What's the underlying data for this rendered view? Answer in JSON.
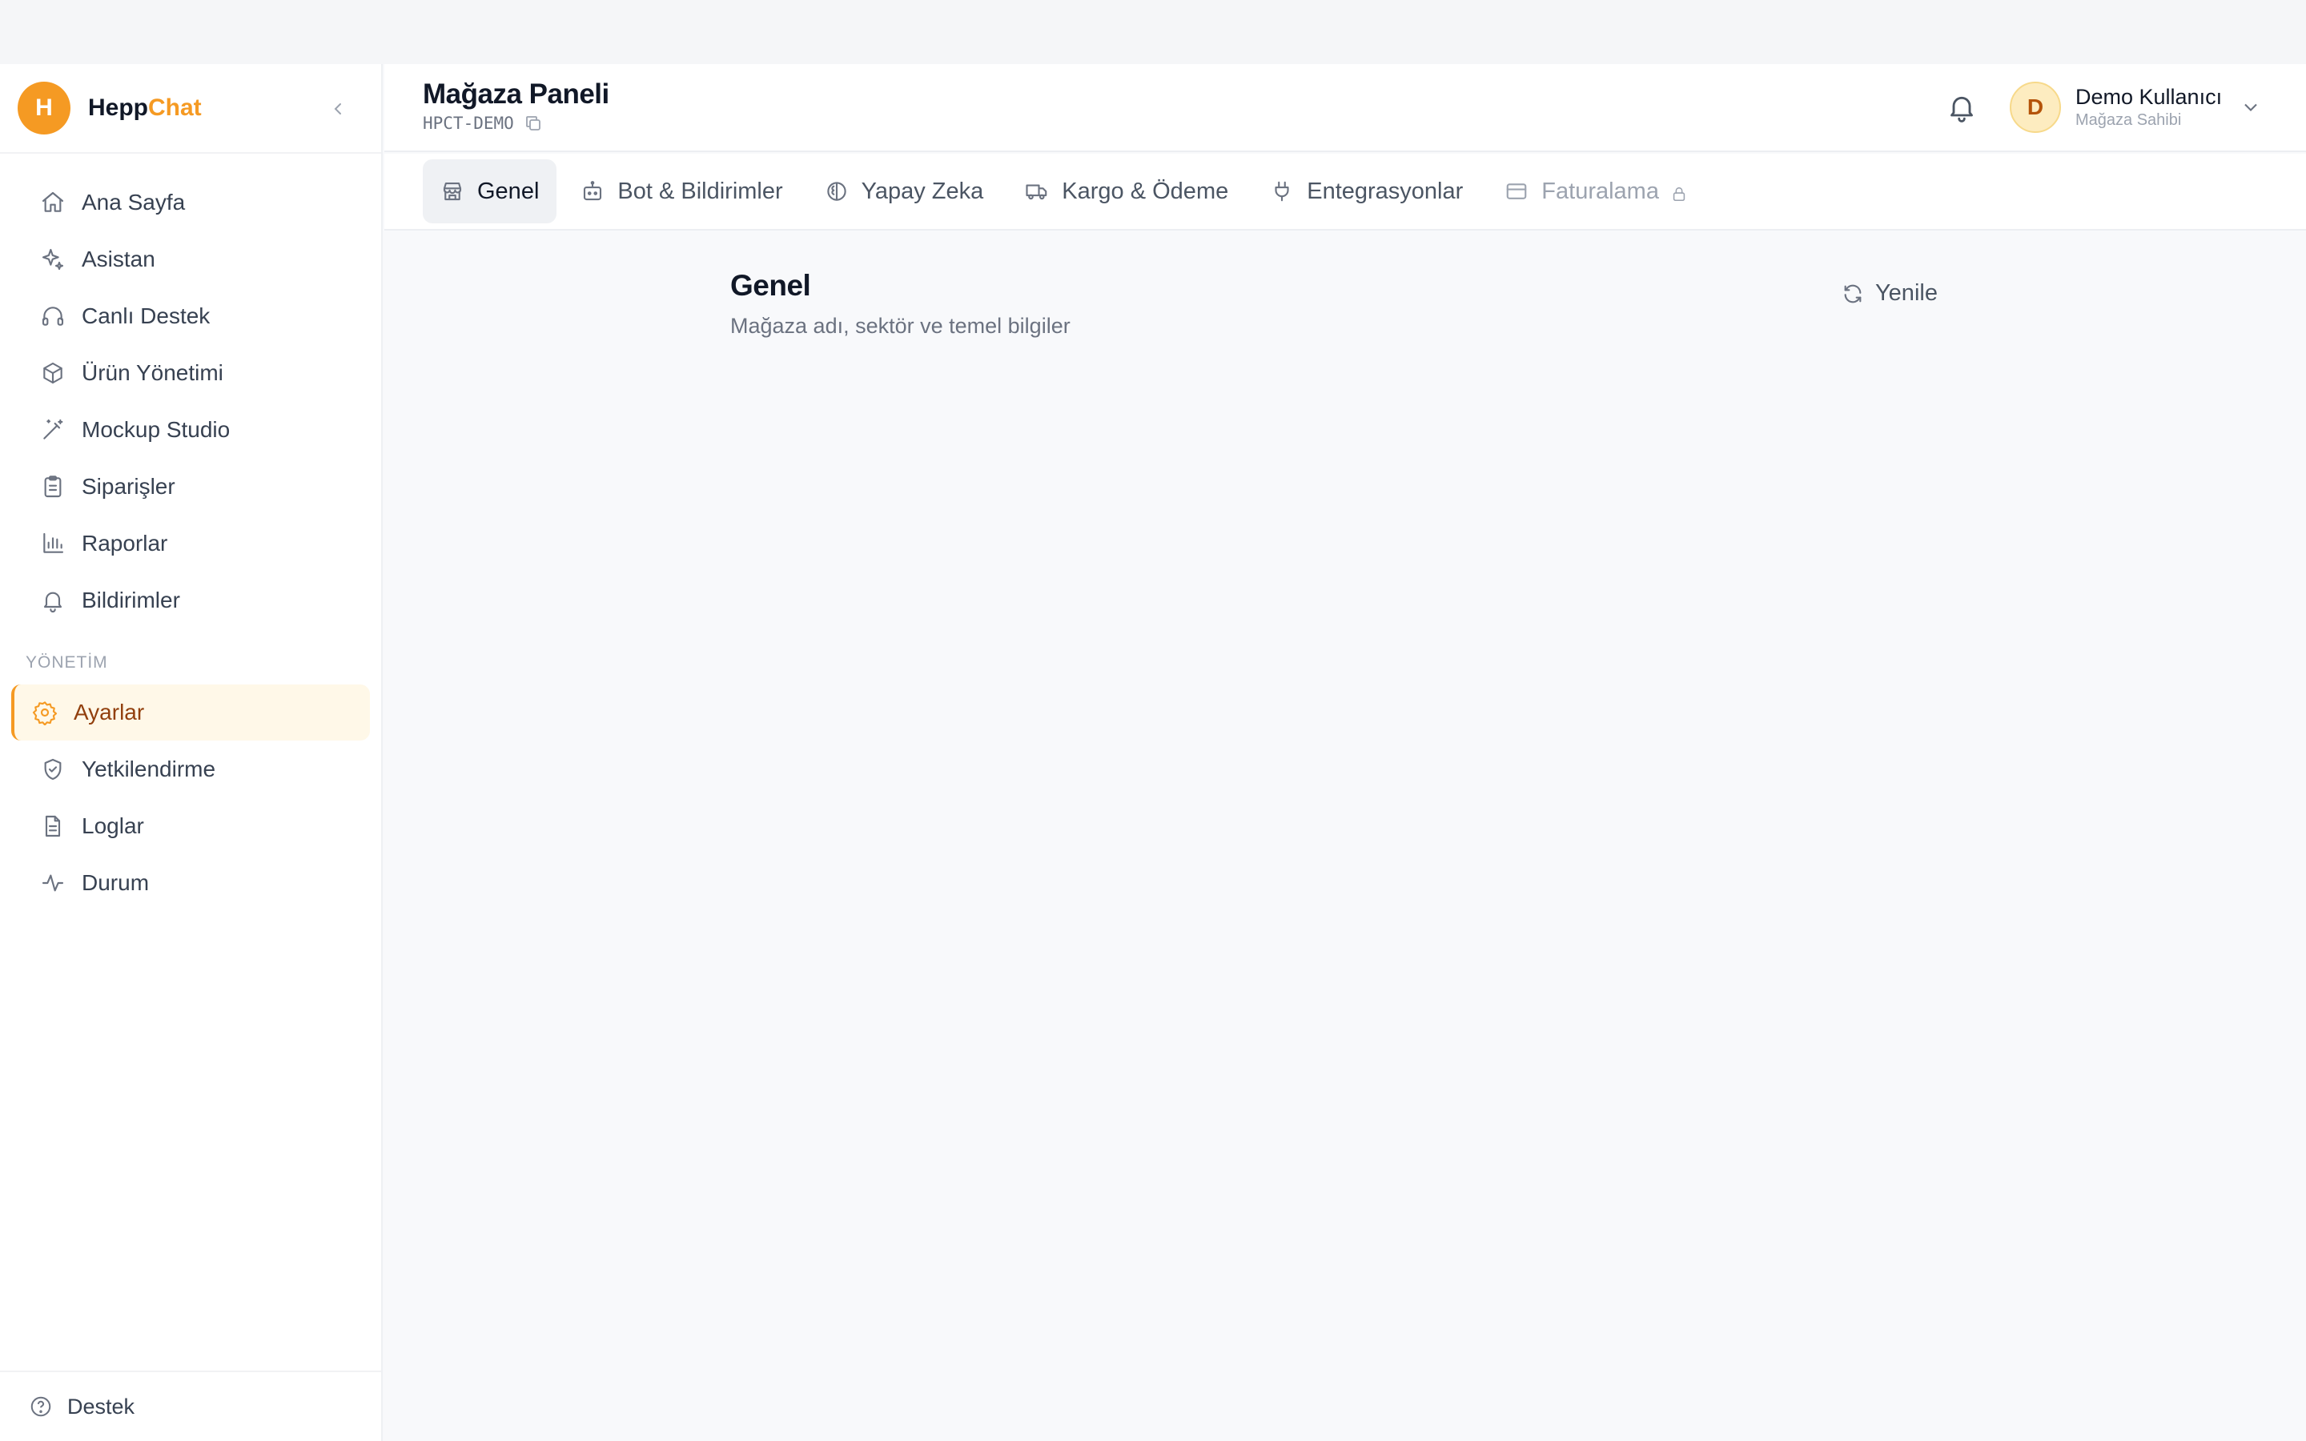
{
  "brand": {
    "logo_letter": "H",
    "name_part1": "Hepp",
    "name_part2": "Chat",
    "accent_color": "#f59a23"
  },
  "sidebar": {
    "items": [
      {
        "label": "Ana Sayfa",
        "icon": "home-icon"
      },
      {
        "label": "Asistan",
        "icon": "sparkles-icon"
      },
      {
        "label": "Canlı Destek",
        "icon": "headphones-icon"
      },
      {
        "label": "Ürün Yönetimi",
        "icon": "package-icon"
      },
      {
        "label": "Mockup Studio",
        "icon": "magic-wand-icon"
      },
      {
        "label": "Siparişler",
        "icon": "clipboard-icon"
      },
      {
        "label": "Raporlar",
        "icon": "bar-chart-icon"
      },
      {
        "label": "Bildirimler",
        "icon": "bell-icon"
      }
    ],
    "section_label": "YÖNETİM",
    "admin_items": [
      {
        "label": "Ayarlar",
        "icon": "gear-icon",
        "active": true
      },
      {
        "label": "Yetkilendirme",
        "icon": "shield-icon"
      },
      {
        "label": "Loglar",
        "icon": "file-icon"
      },
      {
        "label": "Durum",
        "icon": "activity-icon"
      }
    ],
    "footer_label": "Destek"
  },
  "header": {
    "title": "Mağaza Paneli",
    "store_code": "HPCT-DEMO",
    "user_initial": "D",
    "user_name": "Demo Kullanıcı",
    "user_role": "Mağaza Sahibi"
  },
  "tabs": [
    {
      "label": "Genel",
      "icon": "store-icon",
      "active": true
    },
    {
      "label": "Bot & Bildirimler",
      "icon": "bot-icon"
    },
    {
      "label": "Yapay Zeka",
      "icon": "brain-icon"
    },
    {
      "label": "Kargo & Ödeme",
      "icon": "truck-icon"
    },
    {
      "label": "Entegrasyonlar",
      "icon": "plug-icon"
    },
    {
      "label": "Faturalama",
      "icon": "credit-card-icon",
      "locked": true
    }
  ],
  "section": {
    "title": "Genel",
    "subtitle": "Mağaza adı, sektör ve temel bilgiler",
    "refresh_label": "Yenile"
  }
}
